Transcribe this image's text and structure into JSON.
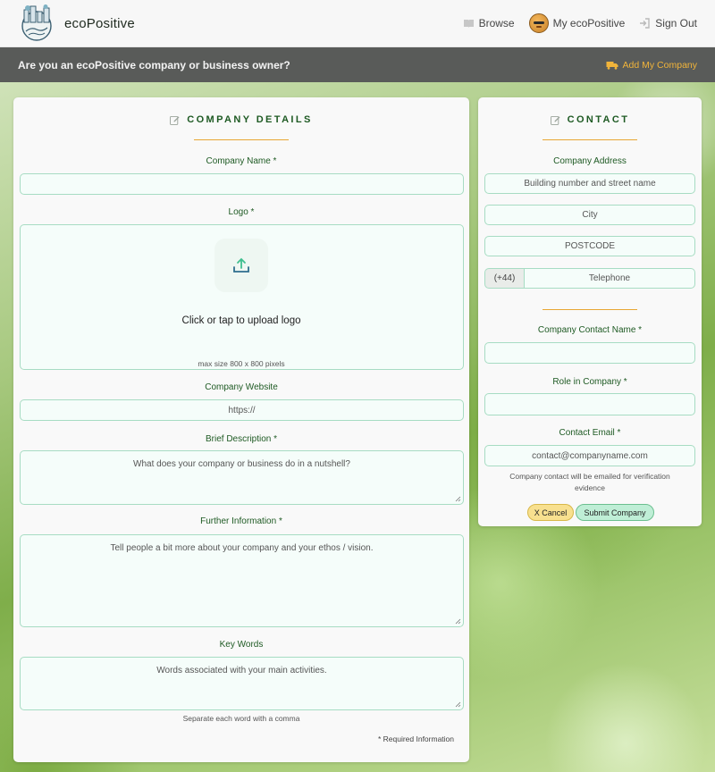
{
  "header": {
    "brand": "ecoPositive",
    "nav": [
      {
        "label": "Browse",
        "icon": "book-icon"
      },
      {
        "label": "My ecoPositive",
        "icon": "avatar-icon"
      },
      {
        "label": "Sign Out",
        "icon": "sign-out-icon"
      }
    ]
  },
  "announce": {
    "question": "Are you an ecoPositive company or business owner?",
    "add_link": "Add My Company"
  },
  "company": {
    "title": "COMPANY DETAILS",
    "name_label": "Company Name *",
    "logo_label": "Logo *",
    "upload_text": "Click or tap to upload logo",
    "logo_hint": "max size 800 x 800 pixels",
    "website_label": "Company Website",
    "website_placeholder": "https://",
    "description_label": "Brief Description *",
    "description_placeholder": "What does your company or business do in a nutshell?",
    "further_label": "Further Information *",
    "further_placeholder": "Tell people a bit more about your company and your ethos / vision.",
    "keywords_label": "Key Words",
    "keywords_placeholder": "Words associated with your main activities.",
    "keywords_hint": "Separate each word with a comma",
    "required_note": "* Required Information"
  },
  "contact": {
    "title": "CONTACT",
    "address_label": "Company Address",
    "street_placeholder": "Building number and street name",
    "city_placeholder": "City",
    "postcode_placeholder": "POSTCODE",
    "tel_prefix": "(+44)",
    "tel_placeholder": "Telephone",
    "contact_name_label": "Company Contact Name *",
    "role_label": "Role in Company *",
    "email_label": "Contact Email *",
    "email_placeholder": "contact@companyname.com",
    "email_hint": "Company contact will be emailed for verification evidence",
    "cancel_label": "X Cancel",
    "submit_label": "Submit Company"
  },
  "colors": {
    "accent_green": "#1e5a23",
    "accent_orange": "#e8a633",
    "field_border": "#a7dcc3",
    "bar_gray": "#595b59"
  }
}
